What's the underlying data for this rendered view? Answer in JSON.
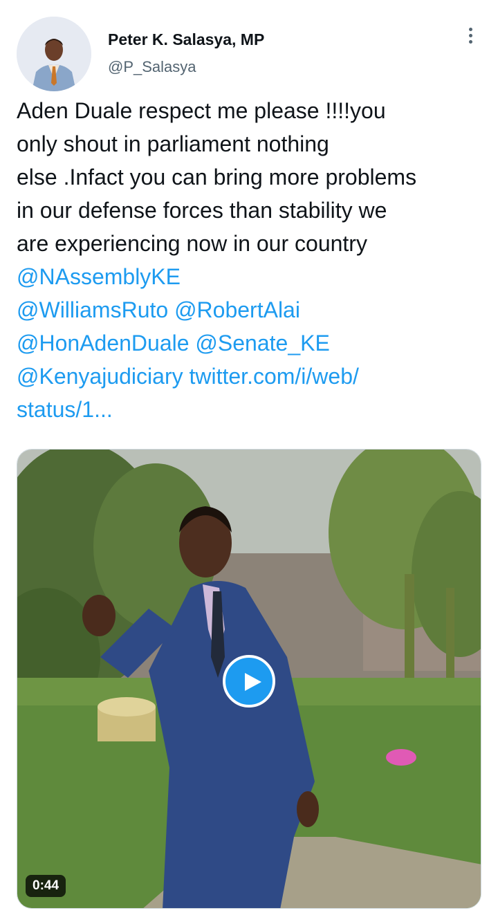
{
  "tweet": {
    "author": {
      "display_name": "Peter K. Salasya, MP",
      "handle": "@P_Salasya",
      "avatar_icon": "profile-photo"
    },
    "menu_icon": "more-vertical-icon",
    "text_lines": [
      {
        "text": "Aden Duale respect me please !!!!you",
        "type": "text"
      },
      {
        "text": "only shout in parliament nothing",
        "type": "text"
      },
      {
        "text": "else .Infact you can bring more problems",
        "type": "text"
      },
      {
        "text": "in our defense forces than stability we",
        "type": "text"
      },
      {
        "text": "are experiencing now in our country",
        "type": "text"
      }
    ],
    "mentions": {
      "line1": "@NAssemblyKE",
      "line2a": "@WilliamsRuto",
      "line2b": "@RobertAlai",
      "line3a": "@HonAdenDuale",
      "line3b": "@Senate_KE",
      "line4a": "@Kenyajudiciary",
      "line4b": "twitter.com/i/web/",
      "line5": "status/1..."
    },
    "media": {
      "type": "video",
      "duration": "0:44",
      "play_icon": "play-icon"
    }
  },
  "colors": {
    "link": "#1d9bf0",
    "text": "#0f1419",
    "secondary": "#536471"
  }
}
